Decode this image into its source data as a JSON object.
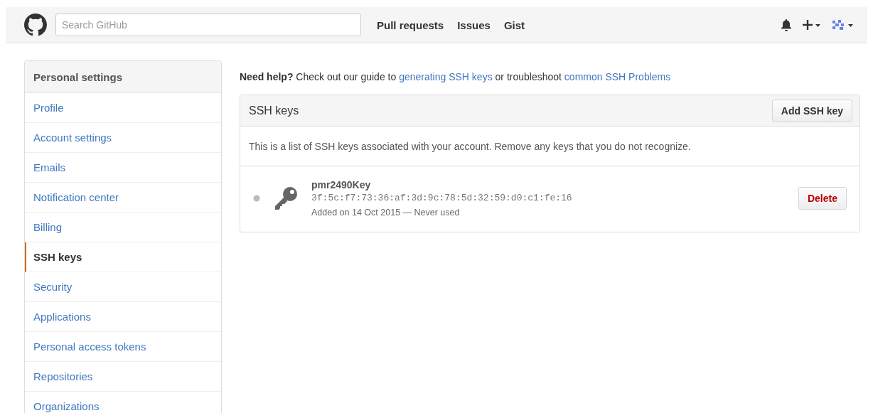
{
  "header": {
    "search": {
      "placeholder": "Search GitHub"
    },
    "nav": [
      "Pull requests",
      "Issues",
      "Gist"
    ]
  },
  "sidebar": {
    "title": "Personal settings",
    "items": [
      {
        "label": "Profile",
        "selected": false
      },
      {
        "label": "Account settings",
        "selected": false
      },
      {
        "label": "Emails",
        "selected": false
      },
      {
        "label": "Notification center",
        "selected": false
      },
      {
        "label": "Billing",
        "selected": false
      },
      {
        "label": "SSH keys",
        "selected": true
      },
      {
        "label": "Security",
        "selected": false
      },
      {
        "label": "Applications",
        "selected": false
      },
      {
        "label": "Personal access tokens",
        "selected": false
      },
      {
        "label": "Repositories",
        "selected": false
      },
      {
        "label": "Organizations",
        "selected": false
      }
    ]
  },
  "help": {
    "lead": "Need help?",
    "text_1": "Check out our guide to",
    "link_1": "generating SSH keys",
    "text_2": "or troubleshoot",
    "link_2": "common SSH Problems"
  },
  "panel": {
    "title": "SSH keys",
    "add_button": "Add SSH key",
    "description": "This is a list of SSH keys associated with your account. Remove any keys that you do not recognize.",
    "keys": [
      {
        "name": "pmr2490Key",
        "fingerprint": "3f:5c:f7:73:36:af:3d:9c:78:5d:32:59:d0:c1:fe:16",
        "meta": "Added on 14 Oct 2015 — Never used",
        "delete": "Delete"
      }
    ]
  }
}
